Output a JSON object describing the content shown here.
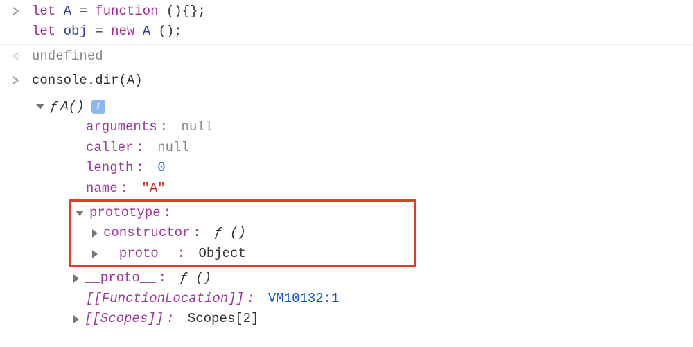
{
  "input1": {
    "line1": {
      "let": "let",
      "A": "A",
      "eq": "=",
      "func": "function",
      "parens": "(){};"
    },
    "line2": {
      "let": "let",
      "obj": "obj",
      "eq": "=",
      "new": "new",
      "A": "A",
      "parens": "();"
    }
  },
  "output1": "undefined",
  "input2": {
    "text": "console.dir(A)"
  },
  "tree": {
    "root": {
      "f": "ƒ",
      "label": "A()"
    },
    "info_glyph": "i",
    "arguments": {
      "key": "arguments",
      "val": "null"
    },
    "caller": {
      "key": "caller",
      "val": "null"
    },
    "length": {
      "key": "length",
      "val": "0"
    },
    "name": {
      "key": "name",
      "val": "\"A\""
    },
    "prototype": {
      "key": "prototype",
      "constructor": {
        "key": "constructor",
        "f": "ƒ ()"
      },
      "proto": {
        "key": "__proto__",
        "val": "Object"
      }
    },
    "proto": {
      "key": "__proto__",
      "f": "ƒ ()"
    },
    "funcloc": {
      "key": "[[FunctionLocation]]",
      "val": "VM10132:1"
    },
    "scopes": {
      "key": "[[Scopes]]",
      "val": "Scopes[2]"
    }
  }
}
